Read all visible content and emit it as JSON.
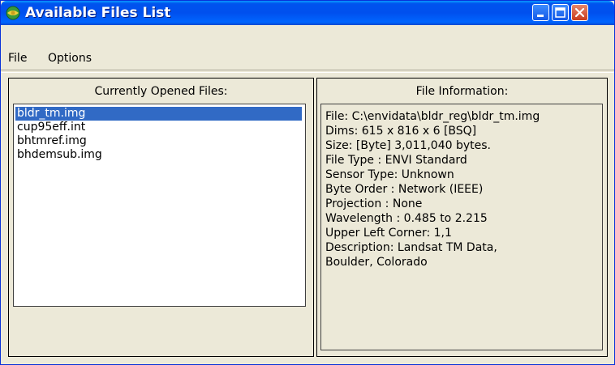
{
  "window": {
    "title": "Available Files List",
    "icon": "globe-icon"
  },
  "titlebar_buttons": {
    "minimize": "minimize-icon",
    "maximize": "maximize-icon",
    "close": "close-icon"
  },
  "menu": {
    "file": "File",
    "options": "Options"
  },
  "left_panel": {
    "title": "Currently Opened Files:",
    "files": [
      "bldr_tm.img",
      "cup95eff.int",
      "bhtmref.img",
      "bhdemsub.img"
    ],
    "selected_index": 0
  },
  "right_panel": {
    "title": "File Information:",
    "lines": [
      "File: C:\\envidata\\bldr_reg\\bldr_tm.img",
      "Dims: 615 x 816 x 6 [BSQ]",
      "Size: [Byte] 3,011,040 bytes.",
      "File Type  : ENVI Standard",
      "Sensor Type: Unknown",
      "Byte Order : Network (IEEE)",
      "Projection : None",
      "Wavelength : 0.485 to 2.215",
      "Upper Left Corner: 1,1",
      "Description: Landsat TM Data,",
      "Boulder, Colorado"
    ]
  },
  "colors": {
    "titlebar": "#0054e3",
    "selection": "#316ac5",
    "face": "#ece9d8"
  }
}
